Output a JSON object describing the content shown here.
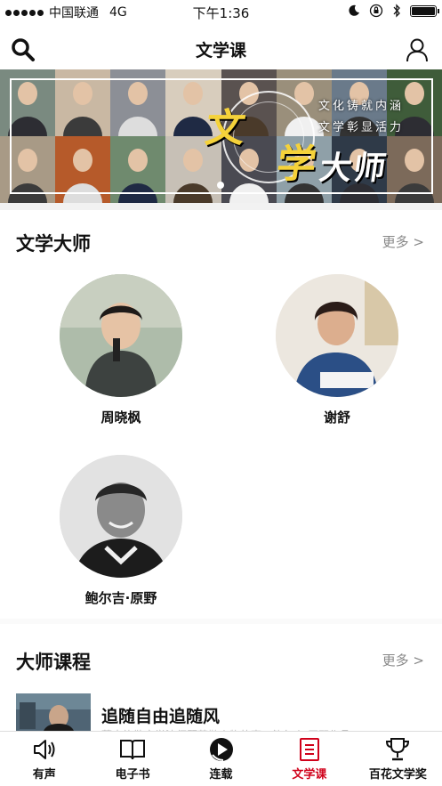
{
  "status_bar": {
    "carrier": "中国联通",
    "network": "4G",
    "time": "下午1:36"
  },
  "nav": {
    "title": "文学课",
    "search_icon": "search-icon",
    "user_icon": "user-icon"
  },
  "banner": {
    "char1": "文",
    "char2": "学",
    "char3": "大",
    "char4": "师",
    "line1": "文化铸就内涵",
    "line2": "文学彰显活力",
    "tile_colors": [
      "#7a8a80",
      "#c9b8a3",
      "#8c8f96",
      "#d8cdbd",
      "#5a5250",
      "#9a8f7b",
      "#6a7a8a",
      "#3f5c3a",
      "#a89a86",
      "#b65a2a",
      "#6f8a6e",
      "#c7c0b6",
      "#4a4a52",
      "#8fa0a8",
      "#2f3a48",
      "#7c6a5a"
    ]
  },
  "masters_section": {
    "title": "文学大师",
    "more": "更多 >",
    "masters": [
      {
        "name": "周晓枫"
      },
      {
        "name": "谢舒"
      },
      {
        "name": "鲍尔吉·原野"
      }
    ]
  },
  "courses_section": {
    "title": "大师课程",
    "more": "更多 >",
    "course": {
      "title": "追随自由追随风",
      "description": "蒙古族散文学法师顾莫勒人物故事，鲍尔吉·原野作品"
    }
  },
  "tabs": [
    {
      "label": "有声",
      "icon": "speaker-icon",
      "active": false
    },
    {
      "label": "电子书",
      "icon": "open-book-icon",
      "active": false
    },
    {
      "label": "连载",
      "icon": "serial-play-icon",
      "active": false
    },
    {
      "label": "文学课",
      "icon": "notebook-icon",
      "active": true
    },
    {
      "label": "百花文学奖",
      "icon": "trophy-icon",
      "active": false
    }
  ],
  "colors": {
    "accent": "#d0021b",
    "banner_gold": "#f5d23a"
  }
}
